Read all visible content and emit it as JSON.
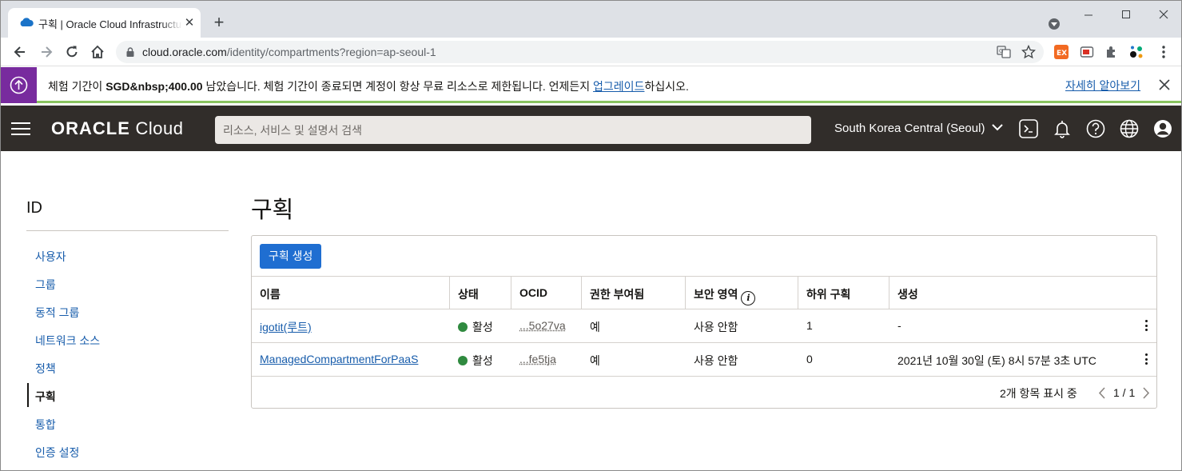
{
  "browser": {
    "tab_title": "구획 | Oracle Cloud Infrastructure",
    "url_host": "cloud.oracle.com",
    "url_path": "/identity/compartments?region=ap-seoul-1"
  },
  "banner": {
    "text_prefix": "체험 기간이 ",
    "amount": "SGD&nbsp;400.00",
    "text_mid": " 남았습니다. 체험 기간이 종료되면 계정이 항상 무료 리소스로 제한됩니다. 언제든지 ",
    "upgrade_link": "업그레이드",
    "text_suffix": "하십시오.",
    "learn_more": "자세히 알아보기"
  },
  "header": {
    "logo_bold": "ORACLE",
    "logo_light": " Cloud",
    "search_placeholder": "리소스, 서비스 및 설명서 검색",
    "region": "South Korea Central (Seoul)"
  },
  "sidebar": {
    "title": "ID",
    "items": [
      {
        "label": "사용자"
      },
      {
        "label": "그룹"
      },
      {
        "label": "동적 그룹"
      },
      {
        "label": "네트워크 소스"
      },
      {
        "label": "정책"
      },
      {
        "label": "구획"
      },
      {
        "label": "통합"
      },
      {
        "label": "인증 설정"
      }
    ]
  },
  "main": {
    "title": "구획",
    "create_button": "구획 생성",
    "columns": [
      "이름",
      "상태",
      "OCID",
      "권한 부여됨",
      "보안 영역",
      "하위 구획",
      "생성"
    ],
    "rows": [
      {
        "name": "igotit(루트)",
        "status": "활성",
        "ocid": "...5o27va",
        "authorized": "예",
        "security_zone": "사용 안함",
        "sub": "1",
        "created": "-"
      },
      {
        "name": "ManagedCompartmentForPaaS",
        "status": "활성",
        "ocid": "...fe5tja",
        "authorized": "예",
        "security_zone": "사용 안함",
        "sub": "0",
        "created": "2021년 10월 30일 (토) 8시 57분 3초 UTC"
      }
    ],
    "footer": "2개 항목 표시 중",
    "page": "1 / 1"
  },
  "colors": {
    "header_bg": "#312d2a",
    "banner_accent": "#782b9e",
    "link": "#175cab",
    "primary_button": "#1f6ed1",
    "status_green": "#2f8a3f"
  }
}
